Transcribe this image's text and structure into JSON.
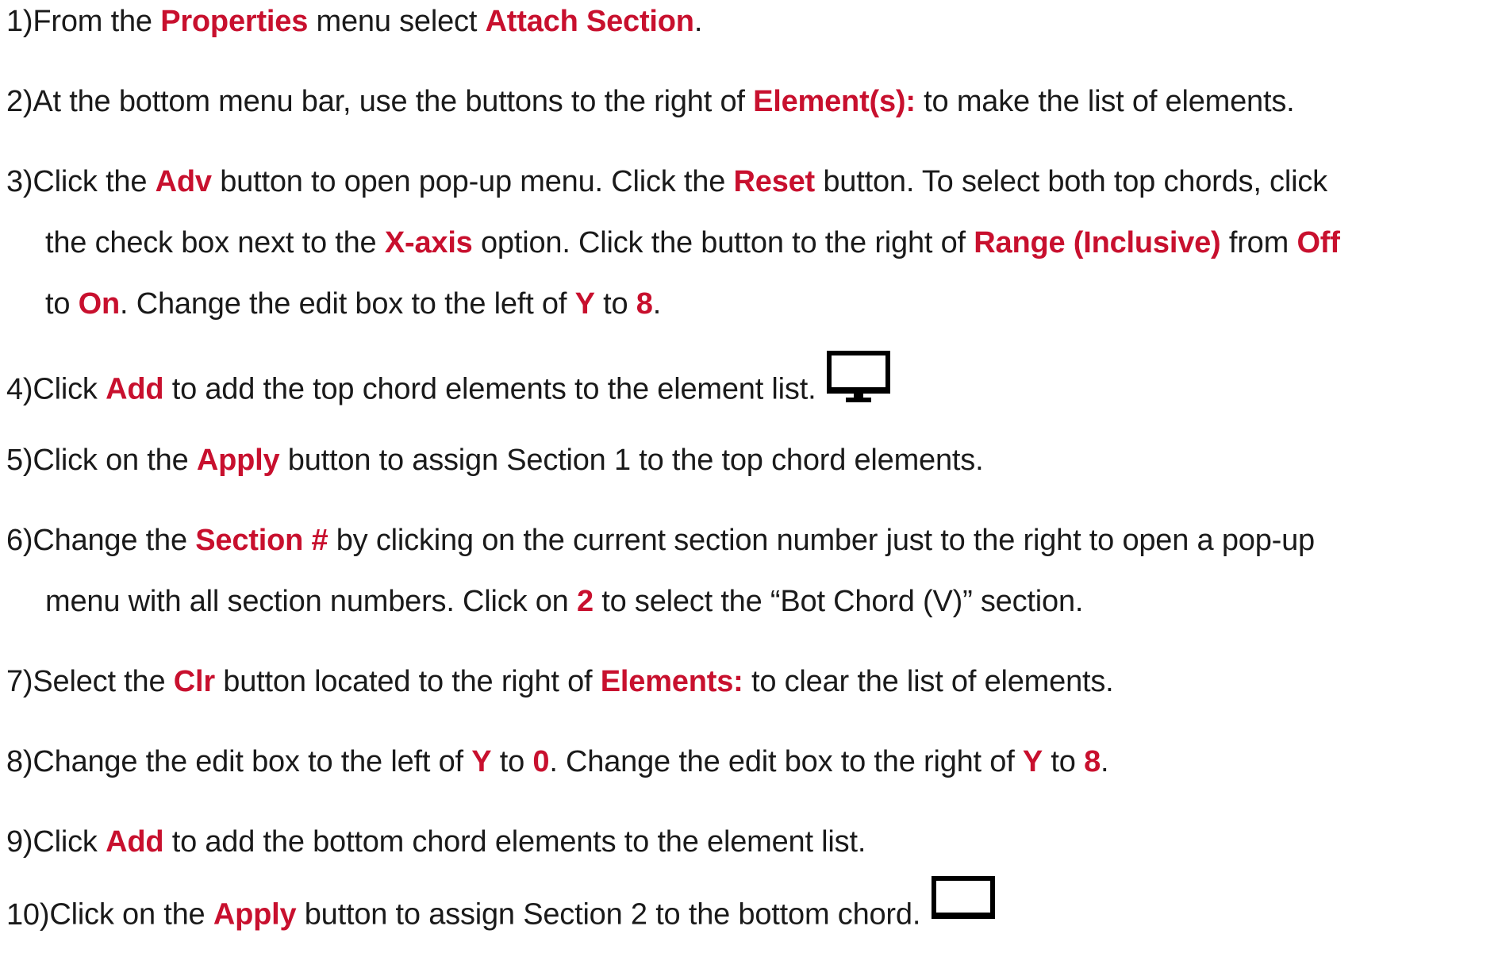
{
  "steps": [
    {
      "num": "1) ",
      "parts": [
        "From the ",
        "Properties",
        " menu select ",
        "Attach Section",
        "."
      ]
    },
    {
      "num": "2) ",
      "parts": [
        "At the bottom menu bar, use the buttons to the right of ",
        "Element(s):",
        " to make the list of elements."
      ]
    },
    {
      "num": "3) ",
      "line1": [
        "Click the ",
        "Adv",
        " button to open pop-up menu. Click the ",
        "Reset",
        " button. To select both top chords, click"
      ],
      "line2": [
        "the check box next to the ",
        "X-axis",
        " option. Click the button to the right of ",
        "Range (Inclusive)",
        " from ",
        "Off"
      ],
      "line3": [
        "to ",
        "On",
        ". Change the edit box to the left of ",
        "Y",
        " to ",
        "8",
        "."
      ]
    },
    {
      "num": "4) ",
      "parts": [
        "Click ",
        "Add",
        " to add the top chord elements to the element list."
      ],
      "icon": "monitor-icon"
    },
    {
      "num": "5) ",
      "parts": [
        "Click on the ",
        "Apply",
        " button to assign Section 1 to the top chord elements."
      ]
    },
    {
      "num": "6) ",
      "line1": [
        "Change the ",
        "Section #",
        " by clicking on the current section number just to the right to open a pop-up"
      ],
      "line2": [
        "menu with all section numbers. Click on ",
        "2",
        " to select the “Bot Chord (V)” section."
      ]
    },
    {
      "num": "7) ",
      "parts": [
        "Select the ",
        "Clr",
        " button located to the right of ",
        "Elements:",
        " to clear the list of elements."
      ]
    },
    {
      "num": "8) ",
      "parts": [
        "Change the edit box to the left of ",
        "Y",
        " to ",
        "0",
        ". Change the edit box to the right of ",
        "Y",
        " to ",
        "8",
        "."
      ]
    },
    {
      "num": "9) ",
      "parts": [
        "Click ",
        "Add",
        " to add the bottom chord elements to the element list."
      ]
    },
    {
      "num": "10)",
      "parts": [
        "Click on the ",
        "Apply",
        " button to assign Section 2 to the bottom chord."
      ],
      "icon": "monitor-outline-icon"
    }
  ],
  "colors": {
    "highlight": "#c8102e",
    "text": "#1a1a1a"
  }
}
